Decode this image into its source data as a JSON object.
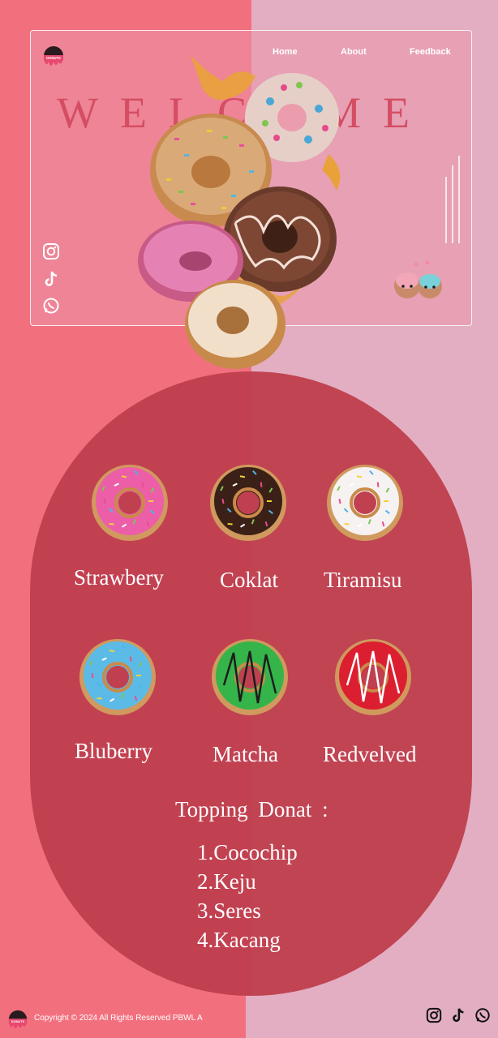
{
  "nav": {
    "home": "Home",
    "about": "About",
    "feedback": "Feedback"
  },
  "hero": {
    "welcome": "WELCOME",
    "logo_text": "DONUTS",
    "social_icons": [
      "instagram-icon",
      "tiktok-icon",
      "whatsapp-icon"
    ]
  },
  "menu": {
    "items": [
      {
        "label": "Strawbery",
        "icon": "strawberry-donut-icon",
        "glaze": "#ec5fa8"
      },
      {
        "label": "Coklat",
        "icon": "chocolate-donut-icon",
        "glaze": "#3b2017"
      },
      {
        "label": "Tiramisu",
        "icon": "tiramisu-donut-icon",
        "glaze": "#f6f2f2"
      },
      {
        "label": "Bluberry",
        "icon": "blueberry-donut-icon",
        "glaze": "#5bbbe6"
      },
      {
        "label": "Matcha",
        "icon": "matcha-donut-icon",
        "glaze": "#35b44a"
      },
      {
        "label": "Redvelved",
        "icon": "redvelvet-donut-icon",
        "glaze": "#dc1f30"
      }
    ]
  },
  "toppings": {
    "title": "Topping  Donat  :",
    "items": [
      "1.Cocochip",
      "2.Keju",
      "3.Seres",
      "4.Kacang"
    ]
  },
  "footer": {
    "copyright": "Copyright © 2024 All Rights Reserved PBWL A",
    "logo_text": "DONUTS"
  },
  "colors": {
    "bg_left": "#f2707e",
    "bg_right": "#e3aec2",
    "panel": "#c0404f",
    "welcome": "#d44d62"
  }
}
